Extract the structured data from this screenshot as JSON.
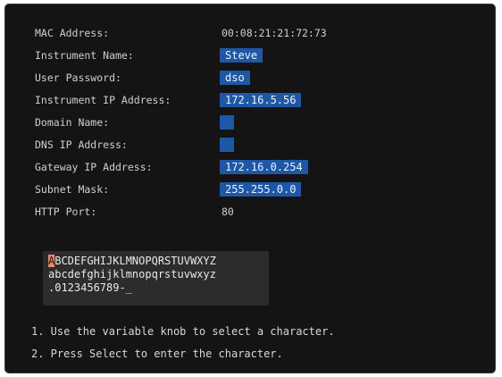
{
  "settings": {
    "mac_address": {
      "label": "MAC Address:",
      "value": "00:08:21:21:72:73"
    },
    "instrument_name": {
      "label": "Instrument Name:",
      "value": "Steve"
    },
    "user_password": {
      "label": "User Password:",
      "value": "dso"
    },
    "instrument_ip": {
      "label": "Instrument IP Address:",
      "value": "172.16.5.56"
    },
    "domain_name": {
      "label": "Domain Name:",
      "value": ""
    },
    "dns_ip": {
      "label": "DNS IP Address:",
      "value": ""
    },
    "gateway_ip": {
      "label": "Gateway IP Address:",
      "value": "172.16.0.254"
    },
    "subnet_mask": {
      "label": "Subnet Mask:",
      "value": "255.255.0.0"
    },
    "http_port": {
      "label": "HTTP Port:",
      "value": "80"
    }
  },
  "charset": {
    "selected_char": "A",
    "line1_rest": "BCDEFGHIJKLMNOPQRSTUVWXYZ",
    "line2": "abcdefghijklmnopqrstuvwxyz",
    "line3": ".0123456789-_"
  },
  "instructions": {
    "step1": "1. Use the variable knob to select a character.",
    "step2": "2. Press Select to enter the character."
  },
  "colors": {
    "background": "#141414",
    "field_highlight": "#1f57a7",
    "cursor_highlight": "#ee8a63",
    "charset_panel": "#2c2c2c"
  }
}
